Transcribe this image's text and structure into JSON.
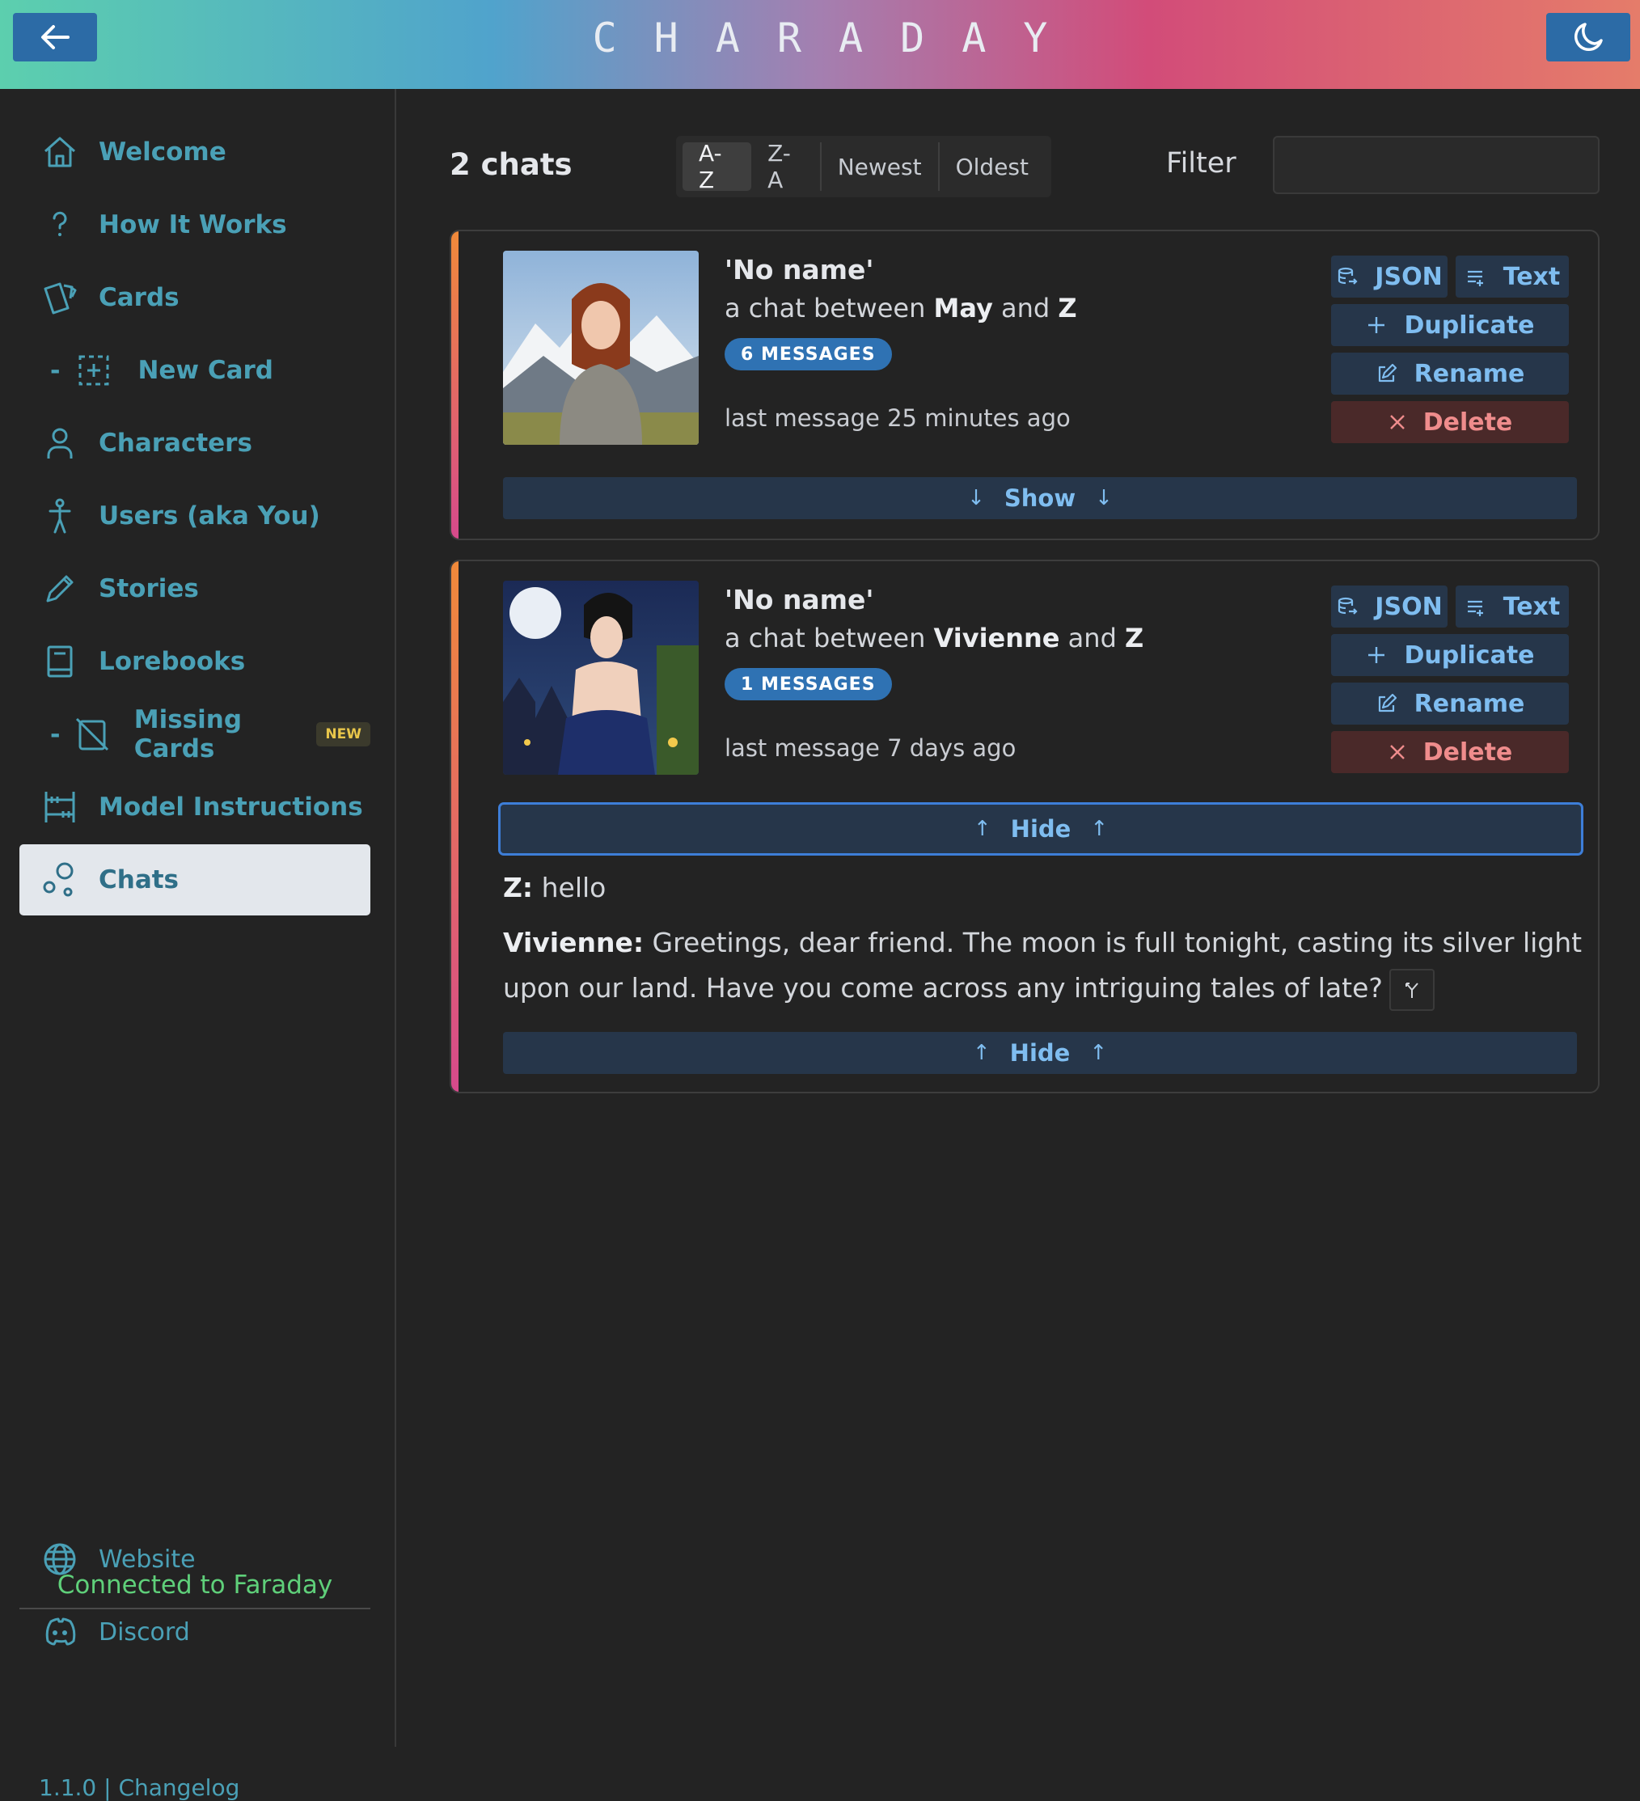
{
  "app": {
    "title": "CHARADAY"
  },
  "sidebar": {
    "items": [
      {
        "label": "Welcome"
      },
      {
        "label": "How It Works"
      },
      {
        "label": "Cards"
      },
      {
        "label": "New Card",
        "prefix": "-"
      },
      {
        "label": "Characters"
      },
      {
        "label": "Users (aka You)"
      },
      {
        "label": "Stories"
      },
      {
        "label": "Lorebooks"
      },
      {
        "label": "Missing Cards",
        "prefix": "-",
        "badge": "NEW"
      },
      {
        "label": "Model Instructions"
      },
      {
        "label": "Chats",
        "active": true
      }
    ],
    "status": "Connected to Faraday",
    "links": [
      {
        "label": "Website"
      },
      {
        "label": "Discord"
      }
    ],
    "version": "1.1.0 | Changelog"
  },
  "toolbar": {
    "count": "2 chats",
    "sort": [
      "A-Z",
      "Z-A",
      "Newest",
      "Oldest"
    ],
    "selected_sort": "A-Z",
    "filter_label": "Filter",
    "filter_value": ""
  },
  "actions": {
    "json": "JSON",
    "text": "Text",
    "duplicate": "Duplicate",
    "rename": "Rename",
    "delete": "Delete"
  },
  "chats": [
    {
      "name": "'No name'",
      "between_prefix": "a chat between",
      "char": "May",
      "and": "and",
      "user": "Z",
      "messages": "6 MESSAGES",
      "last": "last message 25 minutes ago",
      "toggle": "Show"
    },
    {
      "name": "'No name'",
      "between_prefix": "a chat between",
      "char": "Vivienne",
      "and": "and",
      "user": "Z",
      "messages": "1 MESSAGES",
      "last": "last message 7 days ago",
      "toggle": "Hide",
      "conversation": [
        {
          "speaker": "Z:",
          "text": "hello"
        },
        {
          "speaker": "Vivienne:",
          "text": "Greetings, dear friend. The moon is full tonight, casting its silver light upon our land. Have you come across any intriguing tales of late?"
        }
      ]
    }
  ],
  "colors": {
    "accent": "#4aa0b6",
    "button_bg": "#26364a",
    "button_text": "#7fbdf0",
    "delete_bg": "#4a2929",
    "delete_text": "#ef8c8c",
    "badge": "#2f72b3"
  }
}
